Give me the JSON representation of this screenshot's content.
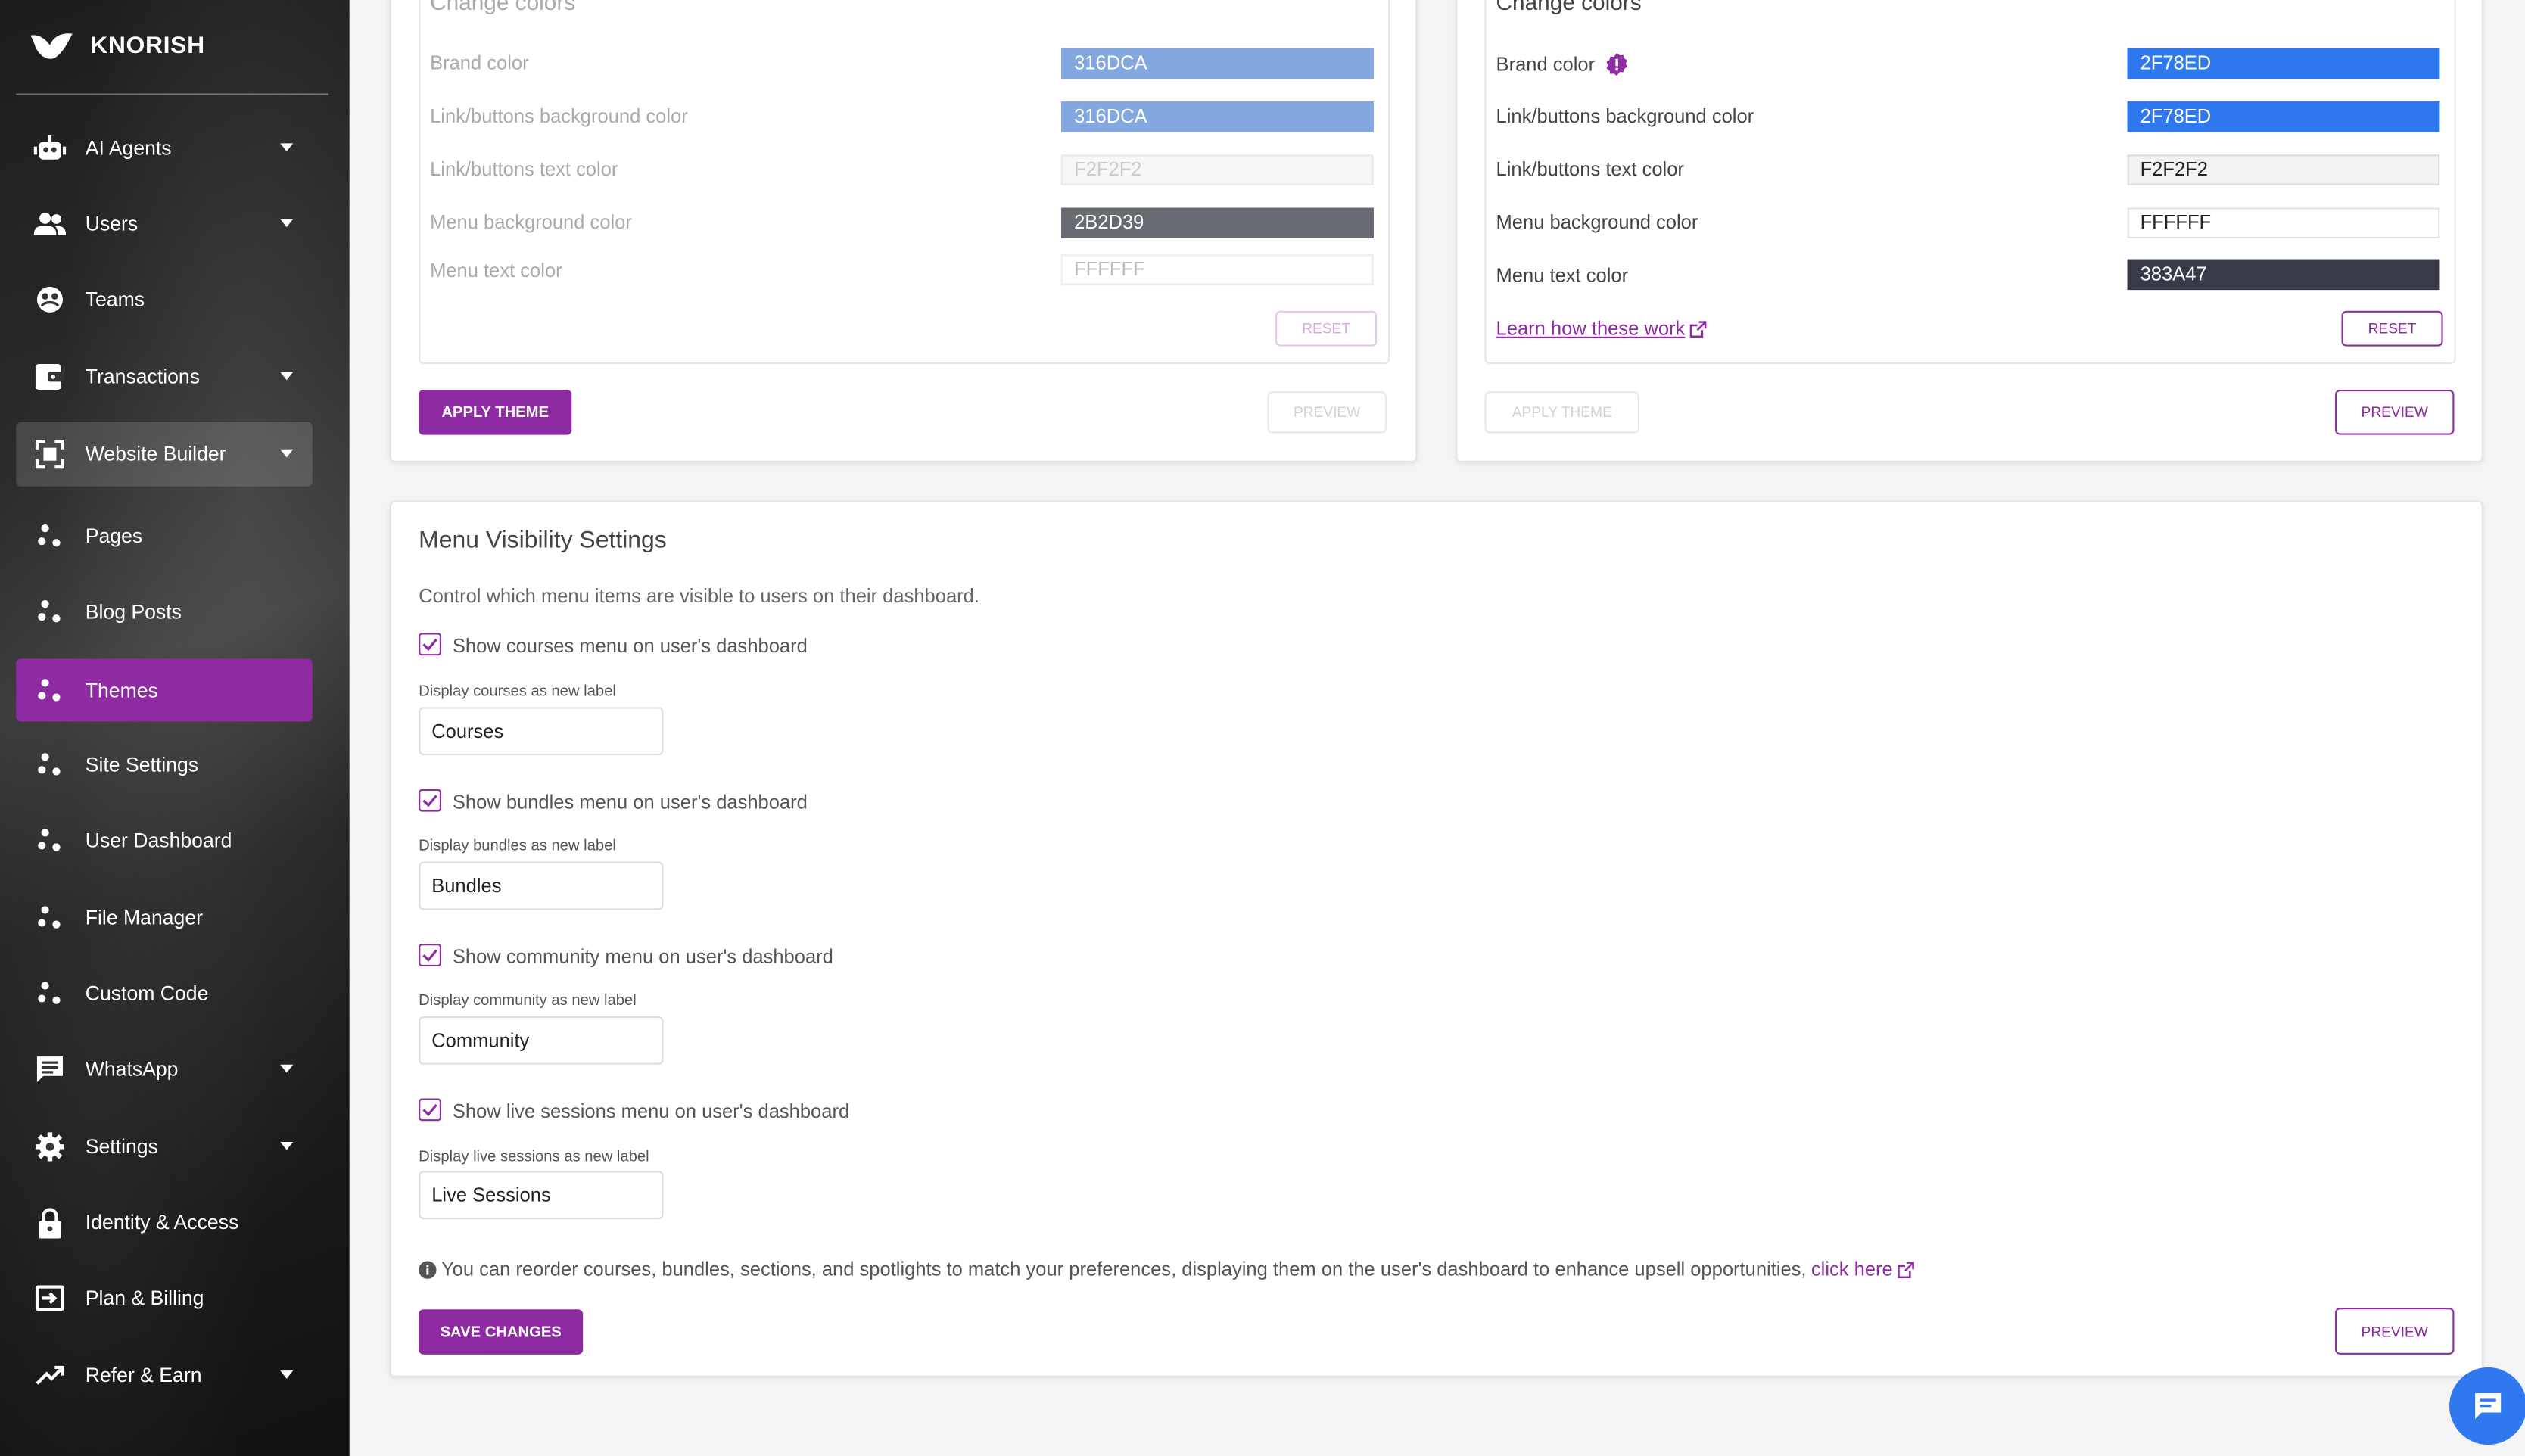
{
  "brand": {
    "name": "KNORISH"
  },
  "sidebar": {
    "items": [
      {
        "label": "AI Agents",
        "icon": "robot-icon",
        "caret": true
      },
      {
        "label": "Users",
        "icon": "users-icon",
        "caret": true
      },
      {
        "label": "Teams",
        "icon": "teams-icon",
        "caret": false
      },
      {
        "label": "Transactions",
        "icon": "wallet-icon",
        "caret": true
      },
      {
        "label": "Website Builder",
        "icon": "website-builder-icon",
        "caret": true
      },
      {
        "label": "Pages",
        "icon": "dots-icon",
        "caret": false
      },
      {
        "label": "Blog Posts",
        "icon": "dots-icon",
        "caret": false
      },
      {
        "label": "Themes",
        "icon": "dots-icon",
        "caret": false
      },
      {
        "label": "Site Settings",
        "icon": "dots-icon",
        "caret": false
      },
      {
        "label": "User Dashboard",
        "icon": "dots-icon",
        "caret": false
      },
      {
        "label": "File Manager",
        "icon": "dots-icon",
        "caret": false
      },
      {
        "label": "Custom Code",
        "icon": "dots-icon",
        "caret": false
      },
      {
        "label": "WhatsApp",
        "icon": "chat-icon",
        "caret": true
      },
      {
        "label": "Settings",
        "icon": "gear-icon",
        "caret": true
      },
      {
        "label": "Identity & Access",
        "icon": "lock-icon",
        "caret": false
      },
      {
        "label": "Plan & Billing",
        "icon": "billing-icon",
        "caret": false
      },
      {
        "label": "Refer & Earn",
        "icon": "trending-up-icon",
        "caret": true
      }
    ]
  },
  "left_theme": {
    "title": "Change colors",
    "rows": [
      {
        "label": "Brand color",
        "value": "316DCA",
        "color": "#316DCA"
      },
      {
        "label": "Link/buttons background color",
        "value": "316DCA",
        "color": "#316DCA"
      },
      {
        "label": "Link/buttons text color",
        "value": "F2F2F2",
        "color": "#F2F2F2"
      },
      {
        "label": "Menu background color",
        "value": "2B2D39",
        "color": "#2B2D39"
      },
      {
        "label": "Menu text color",
        "value": "FFFFFF",
        "color": "#FFFFFF"
      }
    ],
    "reset_label": "RESET",
    "apply_label": "APPLY THEME",
    "preview_label": "PREVIEW"
  },
  "right_theme": {
    "title": "Change colors",
    "rows": [
      {
        "label": "Brand color",
        "value": "2F78ED",
        "color": "#2F78ED"
      },
      {
        "label": "Link/buttons background color",
        "value": "2F78ED",
        "color": "#2F78ED"
      },
      {
        "label": "Link/buttons text color",
        "value": "F2F2F2",
        "color": "#F2F2F2"
      },
      {
        "label": "Menu background color",
        "value": "FFFFFF",
        "color": "#FFFFFF"
      },
      {
        "label": "Menu text color",
        "value": "383A47",
        "color": "#383A47"
      }
    ],
    "learn_link": "Learn how these work",
    "reset_label": "RESET",
    "apply_label": "APPLY THEME",
    "preview_label": "PREVIEW"
  },
  "menu_visibility": {
    "title": "Menu Visibility Settings",
    "description": "Control which menu items are visible to users on their dashboard.",
    "items": [
      {
        "checkbox_label": "Show courses menu on user's dashboard",
        "field_label": "Display courses as new label",
        "value": "Courses",
        "checked": true
      },
      {
        "checkbox_label": "Show bundles menu on user's dashboard",
        "field_label": "Display bundles as new label",
        "value": "Bundles",
        "checked": true
      },
      {
        "checkbox_label": "Show community menu on user's dashboard",
        "field_label": "Display community as new label",
        "value": "Community",
        "checked": true
      },
      {
        "checkbox_label": "Show live sessions menu on user's dashboard",
        "field_label": "Display live sessions as new label",
        "value": "Live Sessions",
        "checked": true
      }
    ],
    "info_text": "You can reorder courses, bundles, sections, and spotlights to match your preferences, displaying them on the user's dashboard to enhance upsell opportunities,",
    "info_link": "click here",
    "save_label": "SAVE CHANGES",
    "preview_label": "PREVIEW"
  },
  "colors": {
    "accent": "#8e2ba3",
    "chat": "#2f78ed"
  }
}
